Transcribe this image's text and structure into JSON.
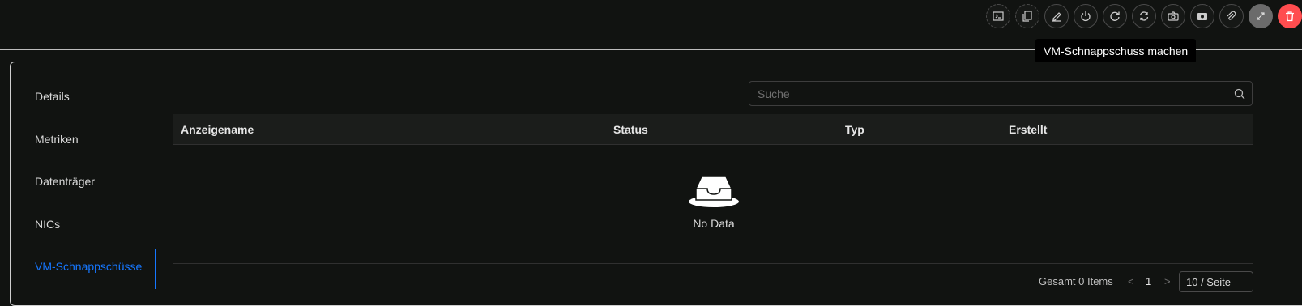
{
  "toolbar": {
    "items": [
      "console-icon",
      "clone-icon",
      "edit-icon",
      "power-icon",
      "restart-icon",
      "sync-icon",
      "camera-icon",
      "snapshot-icon",
      "attach-icon",
      "resize-icon",
      "delete-icon"
    ]
  },
  "tooltip": {
    "text": "VM-Schnappschuss machen"
  },
  "menu": {
    "items": [
      {
        "label": "Details"
      },
      {
        "label": "Metriken"
      },
      {
        "label": "Datenträger"
      },
      {
        "label": "NICs"
      },
      {
        "label": "VM-Schnappschüsse"
      }
    ],
    "active_index": 4
  },
  "search": {
    "placeholder": "Suche"
  },
  "table": {
    "columns": [
      "Anzeigename",
      "Status",
      "Typ",
      "Erstellt"
    ],
    "empty_text": "No Data"
  },
  "pagination": {
    "summary": "Gesamt 0 Items",
    "prev": "<",
    "page": "1",
    "next": ">",
    "page_size": "10 / Seite"
  },
  "colors": {
    "background": "#111311",
    "accent": "#1677ff",
    "danger": "#ff4d4f",
    "tooltip_bg": "#000000"
  }
}
